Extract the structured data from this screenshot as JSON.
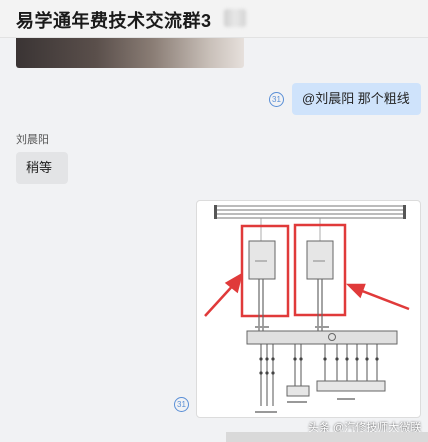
{
  "header": {
    "title": "易学通年费技术交流群3"
  },
  "messages": {
    "outgoing": {
      "read_count": "31",
      "text": "@刘晨阳  那个粗线"
    },
    "incoming": {
      "sender": "刘晨阳",
      "text": "稍等"
    },
    "diagram": {
      "read_count": "31"
    }
  },
  "watermark": {
    "text": "头条 @汽修技师大微联"
  },
  "colors": {
    "outgoing_bubble": "#cfe3fb",
    "incoming_bubble": "#e3e4e6",
    "highlight_box": "#e03a3a",
    "read_badge": "#5a8fd6"
  }
}
